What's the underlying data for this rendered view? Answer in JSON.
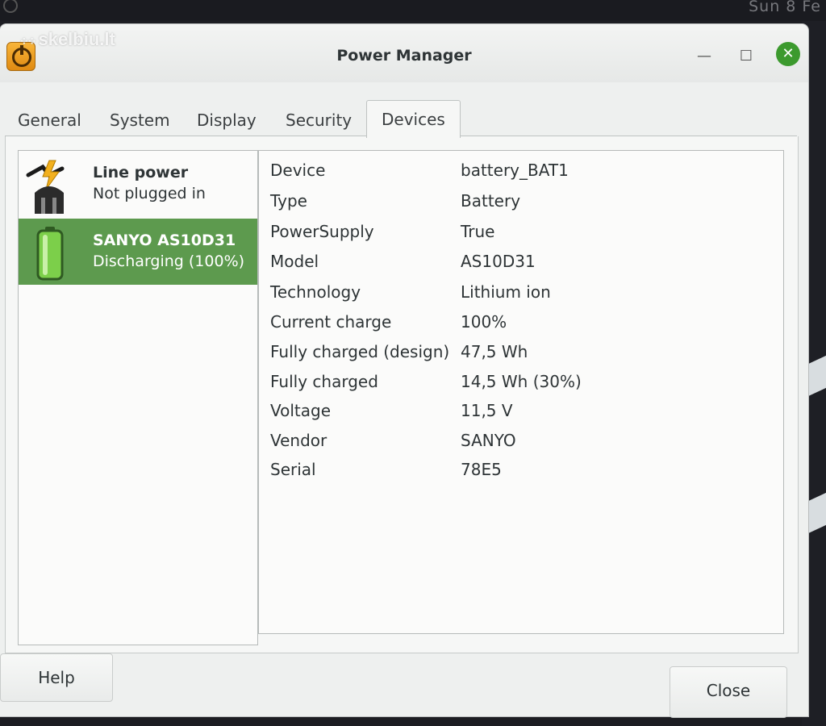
{
  "desktop": {
    "clock": "Sun 8 Fe"
  },
  "watermark": {
    "text": "skelbiu.lt"
  },
  "window": {
    "title": "Power Manager",
    "controls": {
      "minimize": "—",
      "maximize": "☐",
      "close": "✕"
    }
  },
  "tabs": [
    {
      "label": "General"
    },
    {
      "label": "System"
    },
    {
      "label": "Display"
    },
    {
      "label": "Security"
    },
    {
      "label": "Devices",
      "active": true
    }
  ],
  "devices": [
    {
      "name": "Line power",
      "status": "Not plugged in",
      "icon": "line-power-icon",
      "selected": false
    },
    {
      "name": "SANYO AS10D31",
      "status": "Discharging (100%)",
      "icon": "battery-icon",
      "selected": true
    }
  ],
  "properties": [
    {
      "key": "Device",
      "value": "battery_BAT1"
    },
    {
      "key": "Type",
      "value": "Battery"
    },
    {
      "key": "PowerSupply",
      "value": "True"
    },
    {
      "key": "Model",
      "value": "AS10D31"
    },
    {
      "key": "Technology",
      "value": "Lithium ion"
    },
    {
      "key": "Current charge",
      "value": "100%"
    },
    {
      "key": "Fully charged (design)",
      "value": "47,5 Wh"
    },
    {
      "key": "Fully charged",
      "value": "14,5 Wh (30%)"
    },
    {
      "key": "Voltage",
      "value": "11,5 V"
    },
    {
      "key": "Vendor",
      "value": "SANYO"
    },
    {
      "key": "Serial",
      "value": "78E5"
    }
  ],
  "buttons": {
    "help": "Help",
    "close": "Close"
  },
  "colors": {
    "selection": "#5d9a4e",
    "close_button": "#3c9a2e",
    "app_icon": "#f0a020"
  }
}
